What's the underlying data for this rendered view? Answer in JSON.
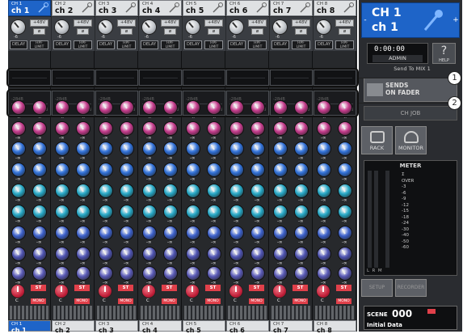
{
  "channels": [
    {
      "num": "CH 1",
      "name": "ch 1"
    },
    {
      "num": "CH 2",
      "name": "ch 2"
    },
    {
      "num": "CH 3",
      "name": "ch 3"
    },
    {
      "num": "CH 4",
      "name": "ch 4"
    },
    {
      "num": "CH 5",
      "name": "ch 5"
    },
    {
      "num": "CH 6",
      "name": "ch 6"
    },
    {
      "num": "CH 7",
      "name": "ch 7"
    },
    {
      "num": "CH 8",
      "name": "ch 8"
    }
  ],
  "strip": {
    "phantom": "+48V",
    "phase": "ø",
    "gain_value": "-6",
    "delay": "DELAY",
    "hpf": "HPF LIMIT",
    "send_db_top": "-28dB",
    "send_db_bottom": "-0dB",
    "knob_value": "-∞",
    "pan_value": "C",
    "st": "ST",
    "mono": "MONO"
  },
  "right": {
    "ch_label_1": "CH 1",
    "ch_label_2": "ch 1",
    "minus": "-",
    "plus": "+",
    "time": "0:00:00",
    "user": "ADMIN",
    "help": "?",
    "help_small": "HELP",
    "send_to": "Send To MIX 1",
    "sends_on_fader": "SENDS\nON FADER",
    "ch_job": "CH JOB",
    "rack": "RACK",
    "monitor": "MONITOR",
    "meter_title": "METER",
    "meter_scale": [
      "Σ",
      "OVER",
      "-3",
      "-6",
      "-9",
      "-12",
      "-15",
      "-18",
      "-24",
      "-30",
      "-40",
      "-50",
      "-60"
    ],
    "meter_lrm": "L  R  M",
    "setup": "SETUP",
    "recorder": "RECORDER",
    "scene_label": "SCENE",
    "scene_num": "000",
    "scene_name": "Initial Data"
  },
  "callouts": [
    "1",
    "2"
  ],
  "colors": {
    "selected": "#1e64c8",
    "knob_rows": [
      "#c23a8a",
      "#c23a8a",
      "#2f6fd6",
      "#2f6fd6",
      "#25a6c4",
      "#25a6c4",
      "#3b5fc9",
      "#4d52b0",
      "#5858b4"
    ]
  }
}
